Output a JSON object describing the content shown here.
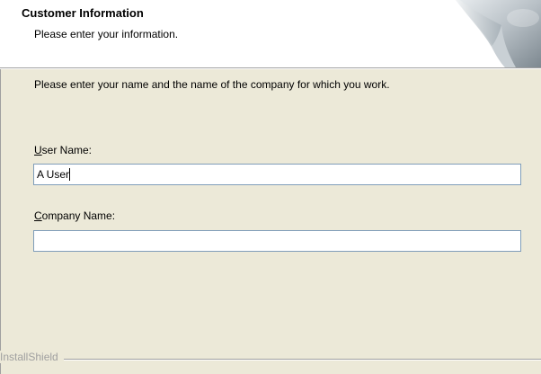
{
  "header": {
    "title": "Customer Information",
    "subtitle": "Please enter your information."
  },
  "main": {
    "intro": "Please enter your name and the name of the company for which you work.",
    "user_name": {
      "label_accel": "U",
      "label_rest": "ser Name:",
      "value": "A User"
    },
    "company_name": {
      "label_accel": "C",
      "label_rest": "ompany Name:",
      "value": ""
    }
  },
  "footer": {
    "brand": "InstallShield"
  },
  "icons": {
    "header_graphic": "page-curl-graphic"
  }
}
